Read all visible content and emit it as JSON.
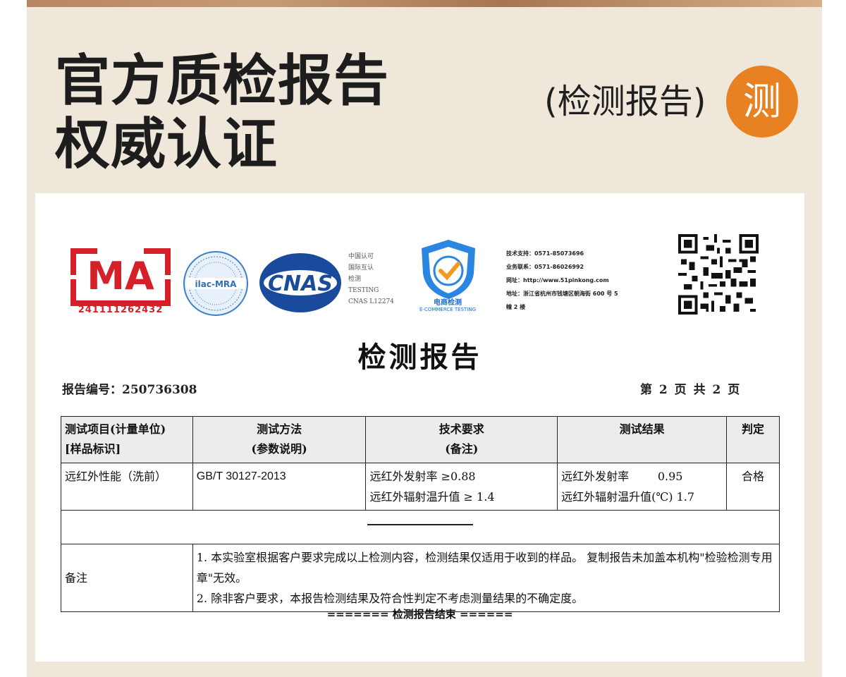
{
  "headline": {
    "line1": "官方质检报告",
    "line2": "权威认证"
  },
  "subhead": "(检测报告)",
  "badge": "测",
  "logos": {
    "cma_text": "MA",
    "cma_number": "241111262432",
    "ilac_text": "ilac-MRA",
    "cnas_text": "CNAS",
    "cnas_caption": [
      "中国认可",
      "国际互认",
      "检测",
      "TESTING",
      "CNAS L12274"
    ],
    "ecom_title": "电商检测",
    "ecom_sub": "E-COMMERCE TESTING"
  },
  "contact": {
    "tech": "技术支持：0571-85073696",
    "business": "业务联系：0571-86026992",
    "website": "网址：http://www.51pinkong.com",
    "address1": "地址：浙江省杭州市钱塘区朝海街 600 号 5",
    "address2": "幢 2 楼"
  },
  "document": {
    "title": "检测报告",
    "report_no": "报告编号：250736308",
    "page_info": "第 2 页 共 2 页",
    "headers": {
      "col1_line1": "测试项目(计量单位)",
      "col1_line2": "[样品标识]",
      "col2_line1": "测试方法",
      "col2_line2": "(参数说明)",
      "col3_line1": "技术要求",
      "col3_line2": "(备注)",
      "col4": "测试结果",
      "col5": "判定"
    },
    "row": {
      "item": "远红外性能（洗前）",
      "method": "GB/T 30127-2013",
      "req1": "远红外发射率 ≥0.88",
      "req2": "远红外辐射温升值 ≥ 1.4",
      "res1": "远红外发射率        0.95",
      "res2": "远红外辐射温升值(℃) 1.7",
      "verdict": "合格"
    },
    "note_label": "备注",
    "note1": "1.    本实验室根据客户要求完成以上检测内容，检测结果仅适用于收到的样品。 复制报告未加盖本机构\"检验检测专用章\"无效。",
    "note2": "2.    除非客户要求，本报告检测结果及符合性判定不考虑测量结果的不确定度。",
    "end_text": "======= 检测报告结束 ======"
  },
  "colors": {
    "accent": "#e88121",
    "panel": "#efe7da",
    "cma_red": "#d52029",
    "cnas_blue": "#1a4a9c"
  }
}
